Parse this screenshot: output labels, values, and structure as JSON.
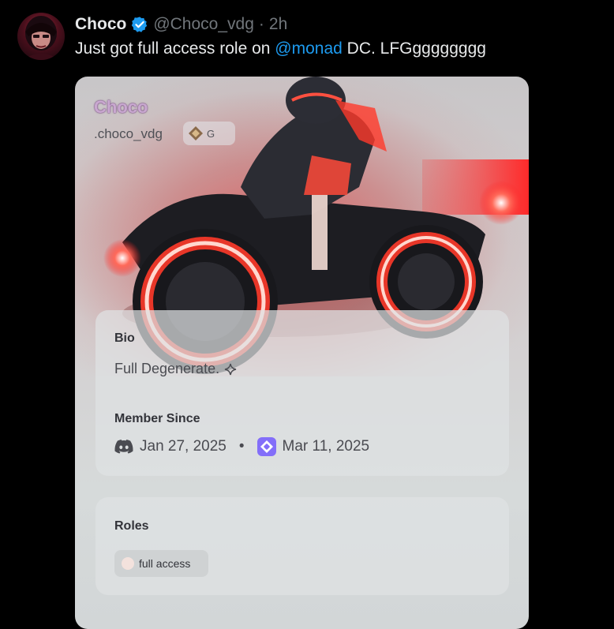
{
  "tweet": {
    "display_name": "Choco",
    "handle": "@Choco_vdg",
    "separator": "·",
    "time": "2h",
    "text_before": "Just got full access role on ",
    "mention": "@monad",
    "text_after": " DC. LFGgggggggg"
  },
  "profile": {
    "name": "Choco",
    "username": ".choco_vdg",
    "guild_tag": "G",
    "bio_label": "Bio",
    "bio_text": "Full Degenerate.",
    "member_since_label": "Member Since",
    "discord_date": "Jan 27, 2025",
    "date_separator": "•",
    "server_date": "Mar 11, 2025",
    "roles_label": "Roles",
    "role_name": "full access"
  },
  "icons": {
    "verified": "verified-badge-icon",
    "guild": "guild-tag-icon",
    "sparkle": "sparkle-icon",
    "discord": "discord-icon",
    "server": "monad-server-icon"
  },
  "colors": {
    "background": "#000000",
    "text": "#e7e9ea",
    "secondary_text": "#71767b",
    "mention": "#1d9bf0",
    "verified": "#1d9bf0",
    "server_icon": "#836ef9",
    "glow": "#ff3030",
    "role_dot": "#f3e2dd"
  }
}
